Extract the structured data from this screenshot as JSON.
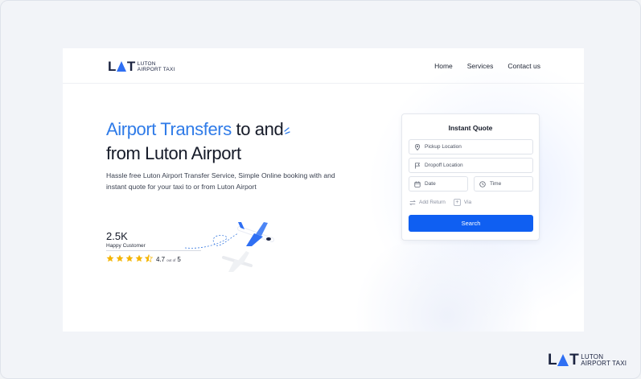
{
  "brand": {
    "mark_left": "L",
    "mark_right": "T",
    "line1": "LUTON",
    "line2": "AIRPORT TAXI",
    "accent_color": "#2f6ff3"
  },
  "nav": {
    "items": [
      "Home",
      "Services",
      "Contact us"
    ]
  },
  "hero": {
    "title_highlight": "Airport Transfers",
    "title_rest_line1": "to and",
    "title_line2": "from Luton Airport",
    "description": "Hassle free Luton Airport Transfer Service, Simple Online booking with and instant quote for your taxi to or from Luton Airport",
    "highlight_color": "#2f7be8"
  },
  "stats": {
    "count": "2.5K",
    "label": "Happy Customer",
    "rating": "4.7",
    "rating_suffix": "out of",
    "rating_max": "5",
    "stars": 4.5
  },
  "quote": {
    "title": "Instant Quote",
    "pickup_placeholder": "Pickup Location",
    "dropoff_placeholder": "Dropoff Location",
    "date_placeholder": "Date",
    "time_placeholder": "Time",
    "add_return_label": "Add Return",
    "via_label": "Via",
    "search_label": "Search",
    "button_color": "#0f5ff2"
  },
  "icons": [
    "pin-icon",
    "flag-icon",
    "calendar-icon",
    "clock-icon",
    "swap-icon",
    "plus-icon",
    "star-icon",
    "airplane-icon"
  ]
}
